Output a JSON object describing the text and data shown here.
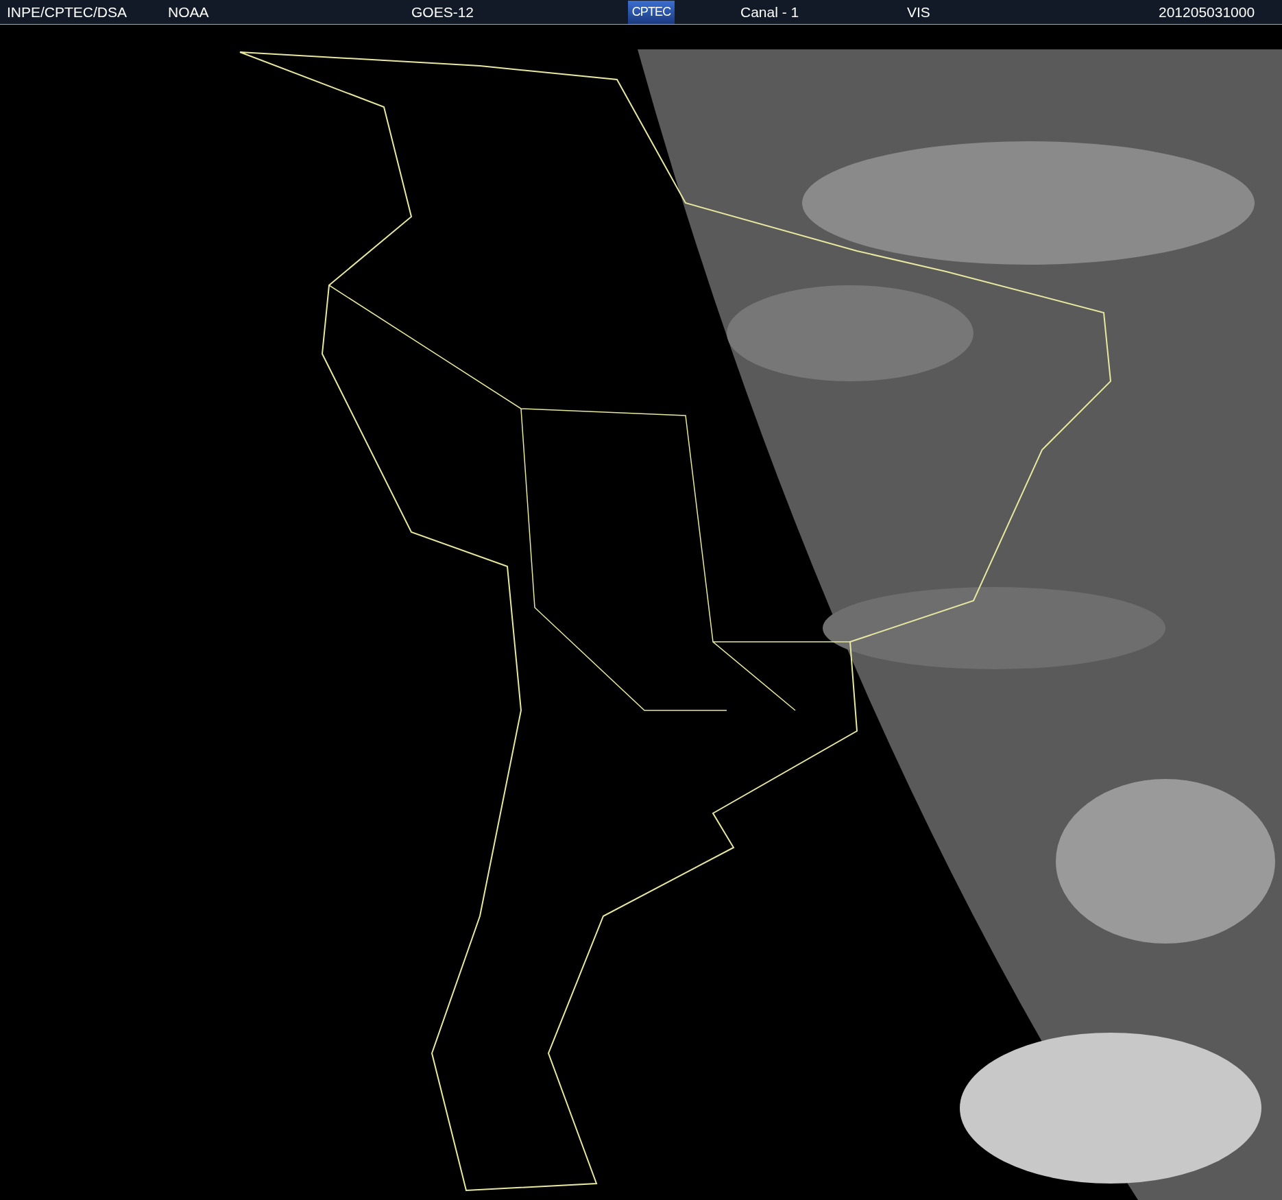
{
  "header": {
    "source": "INPE/CPTEC/DSA",
    "agency": "NOAA",
    "satellite": "GOES-12",
    "logo": "CPTEC",
    "channel": "Canal - 1",
    "band": "VIS",
    "timestamp": "201205031000"
  }
}
